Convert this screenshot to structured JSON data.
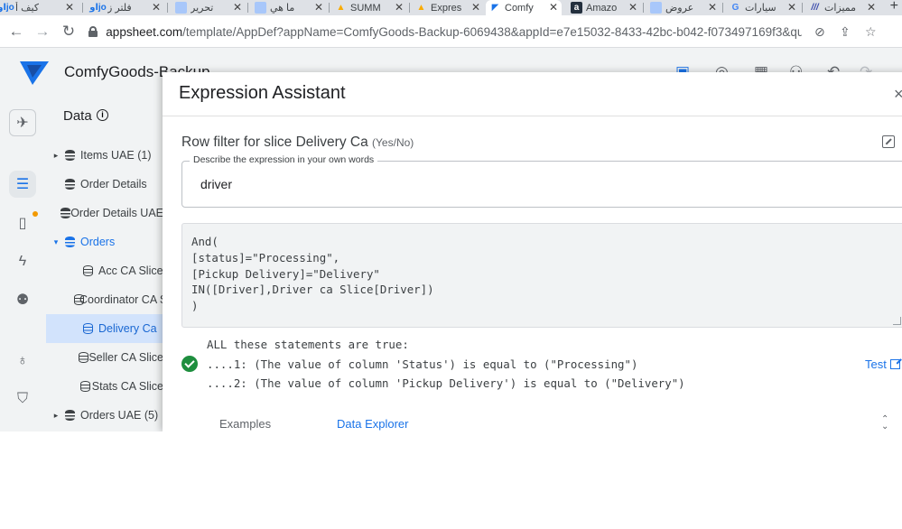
{
  "browser": {
    "tabs": [
      {
        "title": "كيف أ",
        "favicon": "اوjo",
        "active": false
      },
      {
        "title": "فلتر ز",
        "favicon": "اوjo",
        "active": false
      },
      {
        "title": "تحرير",
        "favicon": "doc-icon",
        "active": false
      },
      {
        "title": "ما هي",
        "favicon": "doc-icon",
        "active": false
      },
      {
        "title": "SUMM",
        "favicon": "drive-icon",
        "active": false
      },
      {
        "title": "Expres",
        "favicon": "drive-icon",
        "active": false
      },
      {
        "title": "Comfy",
        "favicon": "appsheet-icon",
        "active": true
      },
      {
        "title": "Amazo",
        "favicon": "a",
        "active": false
      },
      {
        "title": "عروض",
        "favicon": "doc-icon",
        "active": false
      },
      {
        "title": "سيارات",
        "favicon": "G",
        "active": false
      },
      {
        "title": "مميزات",
        "favicon": "stripes-icon",
        "active": false
      }
    ],
    "url_host": "appsheet.com",
    "url_path": "/template/AppDef?appName=ComfyGoods-Backup-6069438&appId=e7e15032-8433-42bc-b042-f073497169f3&quickStart..."
  },
  "app": {
    "title": "ComfyGoods-Backup",
    "accent_color": "#1a73e8"
  },
  "data_panel": {
    "title": "Data",
    "items": [
      {
        "label": "Items UAE (1)",
        "kind": "table",
        "caret": "▸",
        "indent": 0
      },
      {
        "label": "Order Details",
        "kind": "table",
        "caret": "",
        "indent": 0
      },
      {
        "label": "Order Details UAE",
        "kind": "table",
        "caret": "",
        "indent": 0
      },
      {
        "label": "Orders",
        "kind": "table",
        "caret": "▾",
        "indent": 0,
        "expanded": true
      },
      {
        "label": "Acc CA Slice",
        "kind": "slice",
        "caret": "",
        "indent": 1
      },
      {
        "label": "Coordinator CA Slice",
        "kind": "slice",
        "caret": "",
        "indent": 1
      },
      {
        "label": "Delivery Ca",
        "kind": "slice",
        "caret": "",
        "indent": 1,
        "selected": true
      },
      {
        "label": "Seller CA Slice",
        "kind": "slice",
        "caret": "",
        "indent": 1
      },
      {
        "label": "Stats CA Slice",
        "kind": "slice",
        "caret": "",
        "indent": 1
      },
      {
        "label": "Orders UAE (5)",
        "kind": "table",
        "caret": "▸",
        "indent": 0
      }
    ]
  },
  "modal": {
    "title": "Expression Assistant",
    "close_label": "×",
    "section_label": "Row filter for slice Delivery Ca",
    "section_hint": "(Yes/No)",
    "describe_legend": "Describe the expression in your own words",
    "describe_value": "driver",
    "expression": "And(\n[status]=\"Processing\",\n[Pickup Delivery]=\"Delivery\"\nIN([Driver],Driver ca Slice[Driver])\n)",
    "result_lines": [
      "ALL these statements are true:",
      "....1: (The value of column 'Status') is equal to (\"Processing\")",
      "....2: (The value of column 'Pickup Delivery') is equal to (\"Delivery\")"
    ],
    "test_label": "Test",
    "bottom_tabs": [
      "Examples",
      "Data Explorer"
    ]
  }
}
